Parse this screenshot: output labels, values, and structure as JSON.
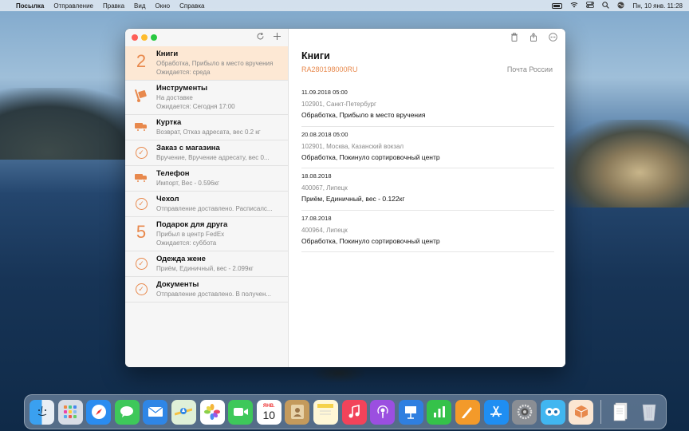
{
  "menubar": {
    "app_name": "Посылка",
    "menus": [
      "Отправление",
      "Правка",
      "Вид",
      "Окно",
      "Справка"
    ],
    "datetime": "Пн, 10 янв.  11:28"
  },
  "sidebar": {
    "items": [
      {
        "title": "Книги",
        "line1": "Обработка, Прибыло в место вручения",
        "line2": "Ожидается: среда",
        "icon": "number",
        "badge": "2",
        "selected": true
      },
      {
        "title": "Инструменты",
        "line1": "На доставке",
        "line2": "Ожидается: Сегодня 17:00",
        "icon": "hand-truck-icon"
      },
      {
        "title": "Куртка",
        "line1": "Возврат, Отказ адресата, вес 0.2 кг",
        "icon": "delivery-truck-icon"
      },
      {
        "title": "Заказ с магазина",
        "line1": "Вручение, Вручение адресату, вес 0...",
        "icon": "checkmark-circle-icon"
      },
      {
        "title": "Телефон",
        "line1": "Импорт, Вес - 0.596кг",
        "icon": "delivery-truck-icon"
      },
      {
        "title": "Чехол",
        "line1": "Отправление доставлено. Расписалс...",
        "icon": "checkmark-circle-icon"
      },
      {
        "title": "Подарок для друга",
        "line1": "Прибыл в центр FedEx",
        "line2": "Ожидается: суббота",
        "icon": "number",
        "badge": "5"
      },
      {
        "title": "Одежда жене",
        "line1": "Приём, Единичный, вес - 2.099кг",
        "icon": "checkmark-circle-icon"
      },
      {
        "title": "Документы",
        "line1": "Отправление доставлено. В получен...",
        "icon": "checkmark-circle-icon"
      }
    ]
  },
  "detail": {
    "title": "Книги",
    "tracking_number": "RA280198000RU",
    "carrier": "Почта России",
    "events": [
      {
        "date": "11.09.2018 05:00",
        "location": "102901, Санкт-Петербург",
        "status": "Обработка, Прибыло в место вручения"
      },
      {
        "date": "20.08.2018 05:00",
        "location": "102901, Москва, Казанский вокзал",
        "status": "Обработка, Покинуло сортировочный центр"
      },
      {
        "date": "18.08.2018",
        "location": "400067, Липецк",
        "status": "Приём, Единичный, вес - 0.122кг"
      },
      {
        "date": "17.08.2018",
        "location": "400964, Липецк",
        "status": "Обработка, Покинуло сортировочный центр"
      }
    ]
  },
  "dock": {
    "calendar_month": "ЯНВ.",
    "calendar_day": "10",
    "apps": [
      "finder",
      "launchpad",
      "safari",
      "messages",
      "mail",
      "maps",
      "photos",
      "facetime",
      "calendar",
      "contacts",
      "notes",
      "music",
      "podcasts",
      "keynote",
      "numbers",
      "pages",
      "app-store",
      "system-preferences",
      "screen-sharing",
      "parcel"
    ]
  },
  "colors": {
    "accent": "#e8894d",
    "selected_row": "#fde8d4"
  }
}
